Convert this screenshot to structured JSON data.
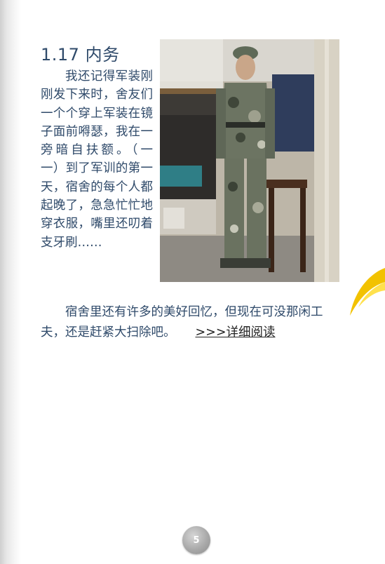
{
  "section": {
    "title": "1.17 内务"
  },
  "intro": {
    "text": "我还记得军装刚刚发下来时，舍友们一个个穿上军装在镜子面前嘚瑟，我在一旁暗自扶额。（一 一）到了军训的第一天，宿舍的每个人都起晚了，急急忙忙地穿衣服，嘴里还叨着支牙刷……"
  },
  "follow": {
    "text": "宿舍里还有许多的美好回忆，但现在可没那闲工夫，还是赶紧大扫除吧。",
    "read_more": ">>>详细阅读"
  },
  "footer": {
    "page_number": "5"
  },
  "colors": {
    "text": "#2f4a6a",
    "link": "#222222",
    "badge": "#a9a9a9",
    "decor": "#f2c200"
  }
}
